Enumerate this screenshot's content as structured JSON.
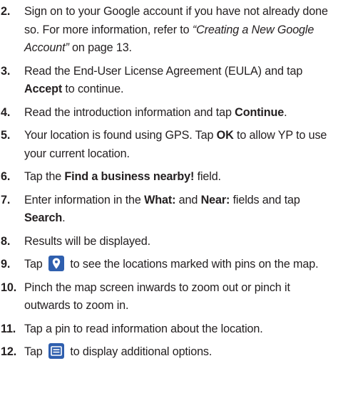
{
  "steps": [
    {
      "num": "2.",
      "a": "Sign on to your Google account if you have not already done so. For more information, refer to ",
      "ref": "“Creating a New Google Account”",
      "b": " on page 13."
    },
    {
      "num": "3.",
      "a": "Read the End-User License Agreement (EULA) and tap ",
      "bold": "Accept",
      "b": " to continue."
    },
    {
      "num": "4.",
      "a": "Read the introduction information and tap ",
      "bold": "Continue",
      "b": "."
    },
    {
      "num": "5.",
      "a": "Your location is found using GPS. Tap ",
      "bold": "OK",
      "b": " to allow YP to use your current location."
    },
    {
      "num": "6.",
      "a": "Tap the ",
      "bold": "Find a business nearby!",
      "b": " field."
    },
    {
      "num": "7.",
      "a": "Enter information in the ",
      "bold1": "What:",
      "mid": " and ",
      "bold2": "Near:",
      "b": " fields and tap ",
      "bold3": "Search",
      "c": "."
    },
    {
      "num": "8.",
      "text": "Results will be displayed."
    },
    {
      "num": "9.",
      "a": "Tap ",
      "icon": "map-pin-icon",
      "b": " to see the locations marked with pins on the map."
    },
    {
      "num": "10.",
      "text": "Pinch the map screen inwards to zoom out or pinch it outwards to zoom in."
    },
    {
      "num": "11.",
      "text": "Tap a pin to read information about the location."
    },
    {
      "num": "12.",
      "a": "Tap ",
      "icon": "menu-icon",
      "b": " to display additional options."
    }
  ],
  "colors": {
    "text": "#231f20",
    "icon_bg": "#2f5fae"
  }
}
